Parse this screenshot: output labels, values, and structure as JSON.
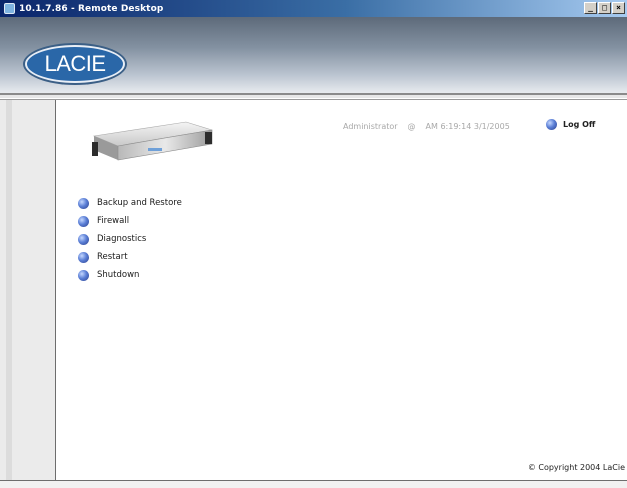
{
  "window": {
    "title": "10.1.7.86 - Remote Desktop",
    "controls": [
      "_",
      "□",
      "×"
    ]
  },
  "brand": {
    "logo_text": "LACIE",
    "accent": "#2a67a8"
  },
  "header": {
    "user": "Administrator",
    "user_marker": "@",
    "timestamp": "AM 6:19:14 3/1/2005",
    "logoff_label": "Log Off"
  },
  "menu": {
    "items": [
      {
        "label": "Backup and Restore",
        "icon": "globe-icon"
      },
      {
        "label": "Firewall",
        "icon": "globe-icon"
      },
      {
        "label": "Diagnostics",
        "icon": "globe-icon"
      },
      {
        "label": "Restart",
        "icon": "globe-icon"
      },
      {
        "label": "Shutdown",
        "icon": "globe-icon"
      }
    ]
  },
  "footer": {
    "copyright": "© Copyright 2004 LaCie"
  }
}
